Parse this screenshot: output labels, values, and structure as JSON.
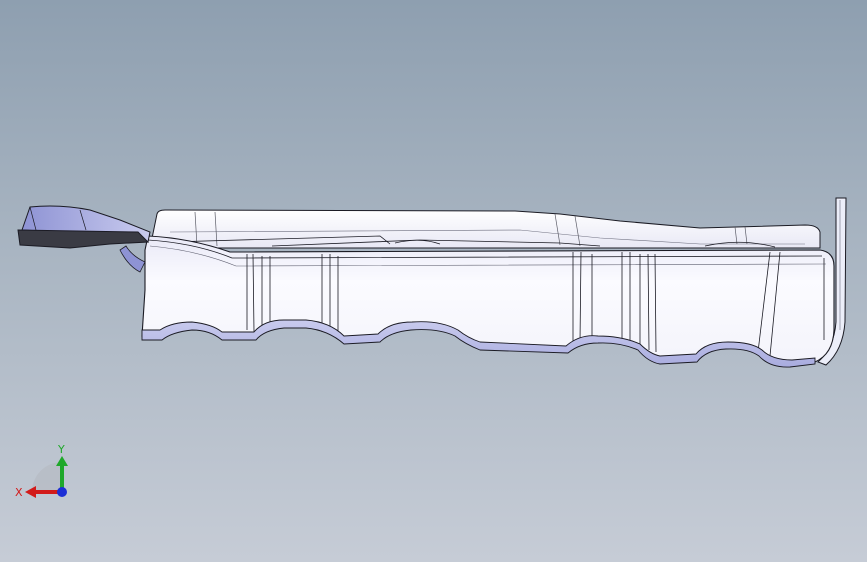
{
  "triad": {
    "x_label": "X",
    "y_label": "Y",
    "x_color": "#d21a1a",
    "y_color": "#1fa82a",
    "z_color": "#1c2fd6",
    "x_icon": "x-axis-arrow-icon",
    "y_icon": "y-axis-arrow-icon",
    "z_icon": "z-axis-dot-icon"
  },
  "colors": {
    "background_top": "#8e9fb0",
    "background_bottom": "#c6ccd6",
    "part_face": "#f3f3fb",
    "part_shadow": "#b9bde3",
    "part_edge": "#1b1b24",
    "part_dark": "#3a3b44"
  }
}
